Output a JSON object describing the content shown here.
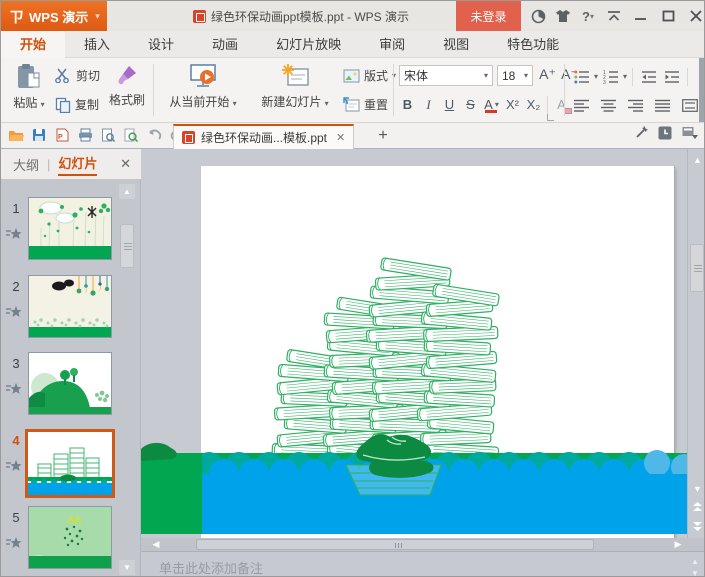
{
  "titlebar": {
    "logo_label": "WPS 演示",
    "document_title": "绿色环保动画ppt模板.ppt - WPS 演示",
    "login_label": "未登录",
    "help_label": "?"
  },
  "menu_tabs": {
    "active": "开始",
    "items": [
      {
        "label": "开始"
      },
      {
        "label": "插入"
      },
      {
        "label": "设计"
      },
      {
        "label": "动画"
      },
      {
        "label": "幻灯片放映"
      },
      {
        "label": "审阅"
      },
      {
        "label": "视图"
      },
      {
        "label": "特色功能"
      }
    ]
  },
  "ribbon": {
    "paste_label": "粘贴",
    "cut_label": "剪切",
    "copy_label": "复制",
    "format_painter_label": "格式刷",
    "play_from_current_label": "从当前开始",
    "new_slide_label": "新建幻灯片",
    "layout_label": "版式",
    "reset_label": "重置",
    "font_name": "宋体",
    "font_size": "18",
    "grow_font_label": "A⁺",
    "shrink_font_label": "A⁻",
    "bold_label": "B",
    "italic_label": "I",
    "underline_label": "U",
    "strike_label": "S",
    "font_color_label": "A",
    "superscript_label": "X²",
    "subscript_label": "X₂",
    "clear_format_label": "A"
  },
  "document_tabs": {
    "active_tab_label": "绿色环保动画...模板.ppt"
  },
  "sidebar": {
    "outline_tab_label": "大纲",
    "slides_tab_label": "幻灯片",
    "selected_slide": "4",
    "slides": [
      {
        "number": "1"
      },
      {
        "number": "2"
      },
      {
        "number": "3"
      },
      {
        "number": "4"
      },
      {
        "number": "5"
      }
    ]
  },
  "notes": {
    "placeholder": "单击此处添加备注"
  },
  "colors": {
    "wps_orange": "#E7661B",
    "accent_orange": "#D2500E",
    "login_red": "#E2614C",
    "green": "#00A650",
    "blue": "#00A2E9",
    "teal": "#00A99D",
    "book_green": "#2FAF62",
    "shoe_green": "#0C8A41",
    "canvas_gray": "#C7CAD0"
  }
}
